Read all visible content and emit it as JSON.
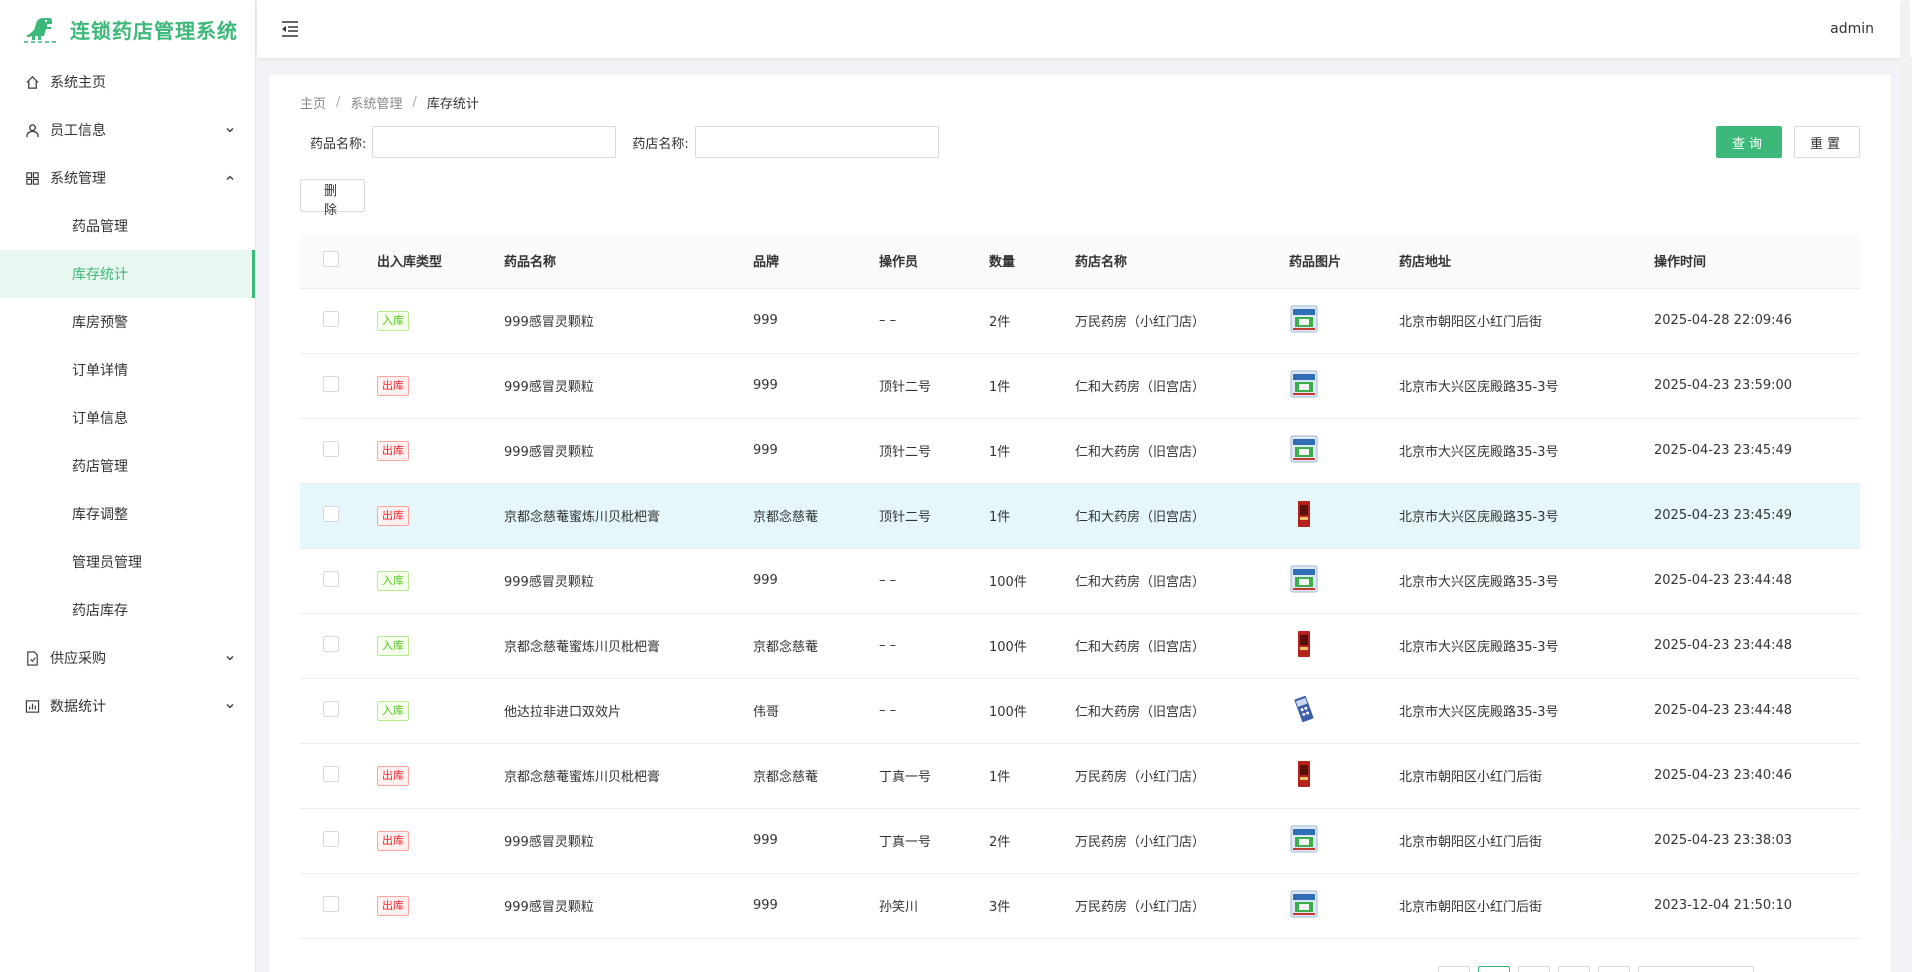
{
  "app": {
    "title": "连锁药店管理系统"
  },
  "header": {
    "user": "admin"
  },
  "sidebar": {
    "items": [
      {
        "label": "系统主页",
        "icon": "home-icon"
      },
      {
        "label": "员工信息",
        "icon": "user-icon",
        "expandable": true,
        "expanded": false
      },
      {
        "label": "系统管理",
        "icon": "grid-icon",
        "expandable": true,
        "expanded": true
      },
      {
        "label": "供应采购",
        "icon": "document-icon",
        "expandable": true,
        "expanded": false
      },
      {
        "label": "数据统计",
        "icon": "chart-icon",
        "expandable": true,
        "expanded": false
      }
    ],
    "sub_items": [
      "药品管理",
      "库存统计",
      "库房预警",
      "订单详情",
      "订单信息",
      "药店管理",
      "库存调整",
      "管理员管理",
      "药店库存"
    ],
    "active_sub": "库存统计"
  },
  "breadcrumb": {
    "home": "主页",
    "parent": "系统管理",
    "current": "库存统计"
  },
  "search": {
    "drug_label": "药品名称:",
    "drug_value": "",
    "store_label": "药店名称:",
    "store_value": "",
    "query_button": "查询",
    "reset_button": "重置"
  },
  "toolbar": {
    "delete_button": "删除"
  },
  "table": {
    "headers": [
      "出入库类型",
      "药品名称",
      "品牌",
      "操作员",
      "数量",
      "药店名称",
      "药品图片",
      "药店地址",
      "操作时间"
    ],
    "rows": [
      {
        "type": "入库",
        "drug": "999感冒灵颗粒",
        "brand": "999",
        "operator": "– –",
        "qty": "2件",
        "store": "万民药房（小红门店）",
        "img": "granule-box",
        "address": "北京市朝阳区小红门后街",
        "time": "2025-04-28 22:09:46"
      },
      {
        "type": "出库",
        "drug": "999感冒灵颗粒",
        "brand": "999",
        "operator": "顶针二号",
        "qty": "1件",
        "store": "仁和大药房（旧宫店）",
        "img": "granule-box",
        "address": "北京市大兴区庑殿路35-3号",
        "time": "2025-04-23 23:59:00"
      },
      {
        "type": "出库",
        "drug": "999感冒灵颗粒",
        "brand": "999",
        "operator": "顶针二号",
        "qty": "1件",
        "store": "仁和大药房（旧宫店）",
        "img": "granule-box",
        "address": "北京市大兴区庑殿路35-3号",
        "time": "2025-04-23 23:45:49"
      },
      {
        "type": "出库",
        "drug": "京都念慈菴蜜炼川贝枇杷膏",
        "brand": "京都念慈菴",
        "operator": "顶针二号",
        "qty": "1件",
        "store": "仁和大药房（旧宫店）",
        "img": "syrup-box",
        "address": "北京市大兴区庑殿路35-3号",
        "time": "2025-04-23 23:45:49",
        "highlight": true
      },
      {
        "type": "入库",
        "drug": "999感冒灵颗粒",
        "brand": "999",
        "operator": "– –",
        "qty": "100件",
        "store": "仁和大药房（旧宫店）",
        "img": "granule-box",
        "address": "北京市大兴区庑殿路35-3号",
        "time": "2025-04-23 23:44:48"
      },
      {
        "type": "入库",
        "drug": "京都念慈菴蜜炼川贝枇杷膏",
        "brand": "京都念慈菴",
        "operator": "– –",
        "qty": "100件",
        "store": "仁和大药房（旧宫店）",
        "img": "syrup-box",
        "address": "北京市大兴区庑殿路35-3号",
        "time": "2025-04-23 23:44:48"
      },
      {
        "type": "入库",
        "drug": "他达拉非进口双效片",
        "brand": "伟哥",
        "operator": "– –",
        "qty": "100件",
        "store": "仁和大药房（旧宫店）",
        "img": "pill-box",
        "address": "北京市大兴区庑殿路35-3号",
        "time": "2025-04-23 23:44:48"
      },
      {
        "type": "出库",
        "drug": "京都念慈菴蜜炼川贝枇杷膏",
        "brand": "京都念慈菴",
        "operator": "丁真一号",
        "qty": "1件",
        "store": "万民药房（小红门店）",
        "img": "syrup-box",
        "address": "北京市朝阳区小红门后街",
        "time": "2025-04-23 23:40:46"
      },
      {
        "type": "出库",
        "drug": "999感冒灵颗粒",
        "brand": "999",
        "operator": "丁真一号",
        "qty": "2件",
        "store": "万民药房（小红门店）",
        "img": "granule-box",
        "address": "北京市朝阳区小红门后街",
        "time": "2025-04-23 23:38:03"
      },
      {
        "type": "出库",
        "drug": "999感冒灵颗粒",
        "brand": "999",
        "operator": "孙笑川",
        "qty": "3件",
        "store": "万民药房（小红门店）",
        "img": "granule-box",
        "address": "北京市朝阳区小红门后街",
        "time": "2023-12-04 21:50:10"
      }
    ]
  },
  "colors": {
    "accent": "#3cb878",
    "in_tag": "#52c41a",
    "out_tag": "#f5222d",
    "highlight_row": "#e6f7fc"
  }
}
